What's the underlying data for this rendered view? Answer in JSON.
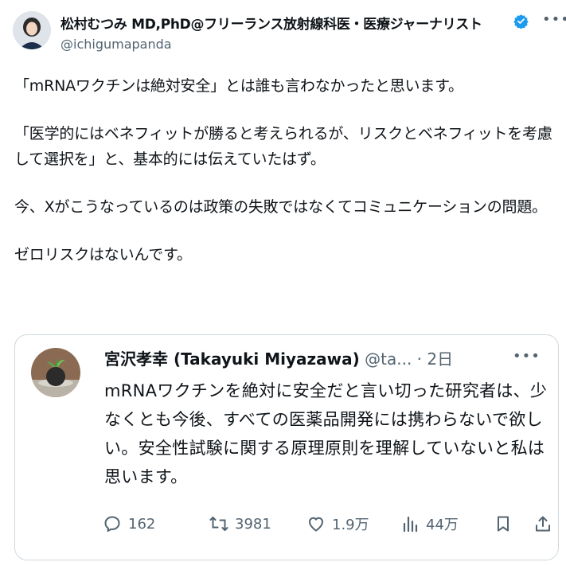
{
  "author": {
    "name": "松村むつみ MD,PhD@フリーランス放射線科医・医療ジャーナリスト",
    "handle": "@ichigumapanda",
    "verified": true,
    "avatar_icon": "profile-photo"
  },
  "tweet": {
    "paragraphs": [
      "「mRNAワクチンは絶対安全」とは誰も言わなかったと思います。",
      "「医学的にはベネフィットが勝ると考えられるが、リスクとベネフィットを考慮して選択を」と、基本的には伝えていたはず。",
      "今、Xがこうなっているのは政策の失敗ではなくてコミュニケーションの問題。",
      "ゼロリスクはないんです。"
    ]
  },
  "quote": {
    "name": "宮沢孝幸 (Takayuki Miyazawa)",
    "handle": "@ta...",
    "time": "2日",
    "text": "mRNAワクチンを絶対に安全だと言い切った研究者は、少なくとも今後、すべての医薬品開発には携わらないで欲しい。安全性試験に関する原理原則を理解していないと私は思います。",
    "actions": {
      "replies": "162",
      "reposts": "3981",
      "likes": "1.9万",
      "views": "44万"
    }
  },
  "colors": {
    "text": "#0f1419",
    "secondary": "#536471",
    "border": "#cfd9de",
    "verified": "#1d9bf0"
  }
}
